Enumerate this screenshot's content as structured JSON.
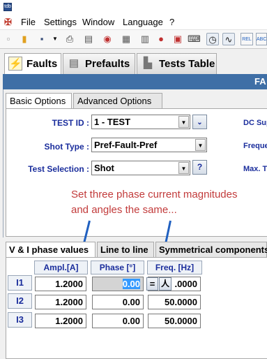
{
  "app": {
    "icon_text": "tdb"
  },
  "menu": {
    "items": [
      "File",
      "Settings",
      "Window",
      "Language",
      "?"
    ]
  },
  "toolbar": {
    "icons": [
      "new-icon",
      "open-icon",
      "save-icon",
      "print-icon",
      "report-icon",
      "test-icon",
      "calc-icon",
      "record-icon",
      "pdf-icon",
      "keyboard-icon",
      "clock-icon",
      "sine-icon",
      "rel-icon",
      "abc-icon"
    ],
    "rel_label": "REL",
    "abc_label": "ABC"
  },
  "main_tabs": [
    {
      "label": "Faults",
      "icon": "lightning-icon"
    },
    {
      "label": "Prefaults",
      "icon": "battery-icon"
    },
    {
      "label": "Tests Table",
      "icon": "tests-table-icon"
    }
  ],
  "banner": {
    "text": "FA"
  },
  "sub_tabs": [
    "Basic Options",
    "Advanced Options"
  ],
  "form": {
    "test_id": {
      "label": "TEST ID :",
      "value": "1 - TEST"
    },
    "shot_type": {
      "label": "Shot Type :",
      "value": "Pref-Fault-Pref"
    },
    "test_selection": {
      "label": "Test Selection :",
      "value": "Shot",
      "help": "?"
    },
    "right_labels": [
      "DC Sup",
      "Freque",
      "Max. T"
    ]
  },
  "annotation": {
    "line1": "Set three phase current magnitudes",
    "line2": "and angles the same..."
  },
  "vi_tabs": [
    "V & I phase values",
    "Line to line",
    "Symmetrical components"
  ],
  "vi_table": {
    "columns": [
      "Ampl.[A]",
      "Phase [°]",
      "Freq. [Hz]"
    ],
    "rows": [
      {
        "name": "I1",
        "ampl": "1.2000",
        "phase": "0.00",
        "freq": ".0000"
      },
      {
        "name": "I2",
        "ampl": "1.2000",
        "phase": "0.00",
        "freq": "50.0000"
      },
      {
        "name": "I3",
        "ampl": "1.2000",
        "phase": "0.00",
        "freq": "50.0000"
      }
    ],
    "equal_button": "=",
    "lock_button": "人"
  }
}
